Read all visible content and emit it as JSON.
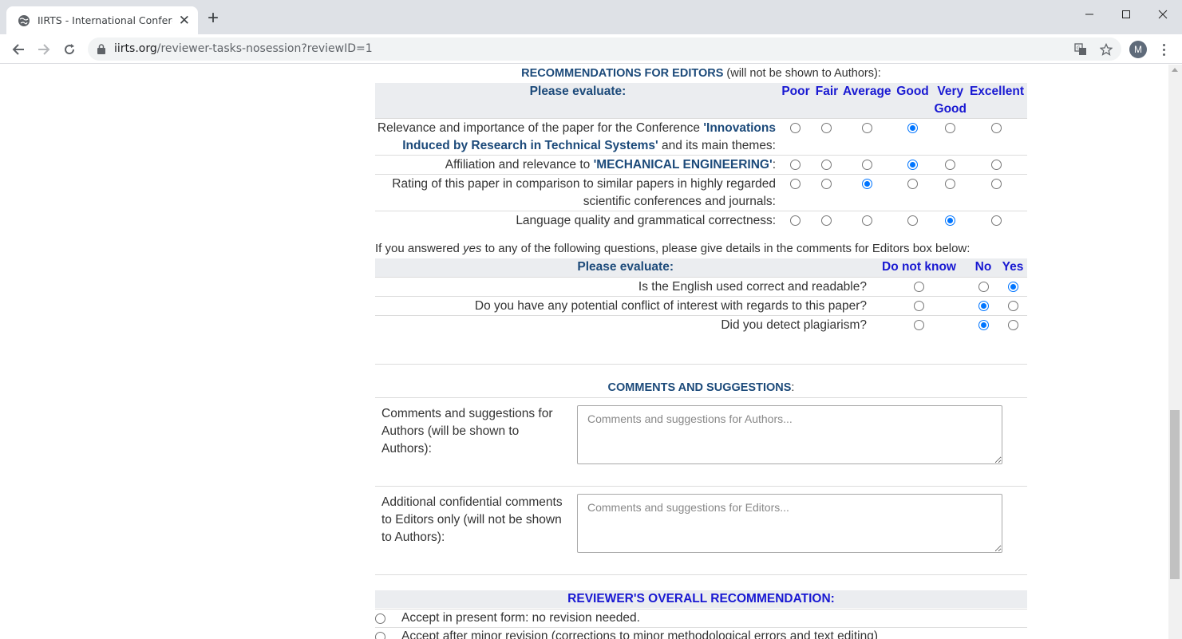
{
  "browser": {
    "tab_title": "IIRTS - International Conference on",
    "url_host": "iirts.org",
    "url_path": "/reviewer-tasks-nosession?reviewID=1",
    "profile_initial": "M"
  },
  "editors": {
    "heading": "RECOMMENDATIONS FOR EDITORS",
    "heading_note": " (will not be shown to Authors):",
    "evaluate_label": "Please evaluate:",
    "columns": [
      "Poor",
      "Fair",
      "Average",
      "Good",
      "Very Good",
      "Excellent"
    ],
    "rows": [
      {
        "pre": "Relevance and importance of the paper for the Conference ",
        "hl": "'Innovations Induced by Research in Technical Systems'",
        "post": " and its main themes:",
        "selected": 3
      },
      {
        "pre": "Affiliation and relevance to ",
        "hl": "'MECHANICAL ENGINEERING'",
        "post": ":",
        "selected": 3
      },
      {
        "pre": "Rating of this paper in comparison to similar papers in highly regarded scientific conferences and journals:",
        "hl": "",
        "post": "",
        "selected": 2
      },
      {
        "pre": "Language quality and grammatical correctness:",
        "hl": "",
        "post": "",
        "selected": 4
      }
    ]
  },
  "yesno": {
    "intro_pre": "If you answered ",
    "intro_em": "yes",
    "intro_post": " to any of the following questions, please give details in the comments for Editors box below:",
    "evaluate_label": "Please evaluate:",
    "columns": [
      "Do not know",
      "No",
      "Yes"
    ],
    "rows": [
      {
        "text": "Is the English used correct and readable?",
        "selected": 2
      },
      {
        "text": "Do you have any potential conflict of interest with regards to this paper?",
        "selected": 1
      },
      {
        "text": "Did you detect plagiarism?",
        "selected": 1
      }
    ]
  },
  "comments": {
    "heading": "COMMENTS AND SUGGESTIONS",
    "heading_suffix": ":",
    "authors_label": "Comments and suggestions for Authors (will be shown to Authors):",
    "authors_placeholder": "Comments and suggestions for Authors...",
    "editors_label": "Additional confidential comments to Editors only (will not be shown to Authors):",
    "editors_placeholder": "Comments and suggestions for Editors..."
  },
  "recommendation": {
    "heading": "REVIEWER'S OVERALL RECOMMENDATION:",
    "options": [
      "Accept in present form: no revision needed.",
      "Accept after minor revision (corrections to minor methodological errors and text editing)"
    ]
  }
}
